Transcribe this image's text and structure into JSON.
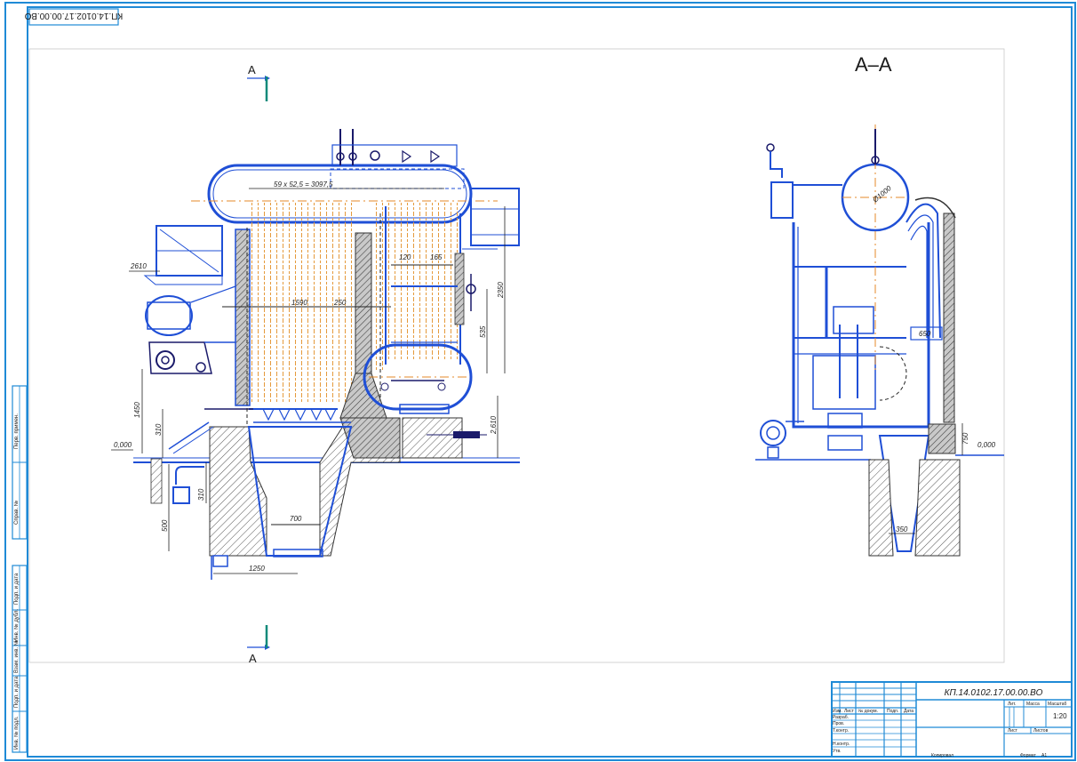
{
  "stamp_code_rotated": "КП.14.0102.17.00.00.ВО",
  "section_marker": "А",
  "section_view_title": "А–А",
  "title_block": {
    "designation": "КП.14.0102.17.00.00.ВО",
    "col_headers": [
      "Изм.",
      "Лист",
      "№ докум.",
      "Подп.",
      "Дата"
    ],
    "row_labels": [
      "Разраб.",
      "Пров.",
      "Т.контр.",
      "Н.контр.",
      "Утв."
    ],
    "lit_label": "Лит.",
    "mass_label": "Масса",
    "scale_label": "Масштаб",
    "scale_value": "1:20",
    "sheet_label": "Лист",
    "sheets_label": "Листов",
    "copied_label": "Копировал",
    "format_label": "Формат",
    "format_value": "А1"
  },
  "left_strip": [
    "Перв. примен.",
    "Справ. №",
    "Подп. и дата",
    "Инв. № дубл.",
    "Взам. инв. №",
    "Подп. и дата",
    "Инв. № подл."
  ],
  "front_view": {
    "top_label": "59 х 52,5 = 3097,5",
    "dims": [
      "2610",
      "1590",
      "250",
      "120",
      "165",
      "2350",
      "535",
      "1450",
      "310",
      "0,000",
      "310",
      "500",
      "700",
      "1250",
      "2,610"
    ]
  },
  "section_view": {
    "dims": [
      "Ø1000",
      "650",
      "750",
      "0,000",
      "350"
    ]
  }
}
